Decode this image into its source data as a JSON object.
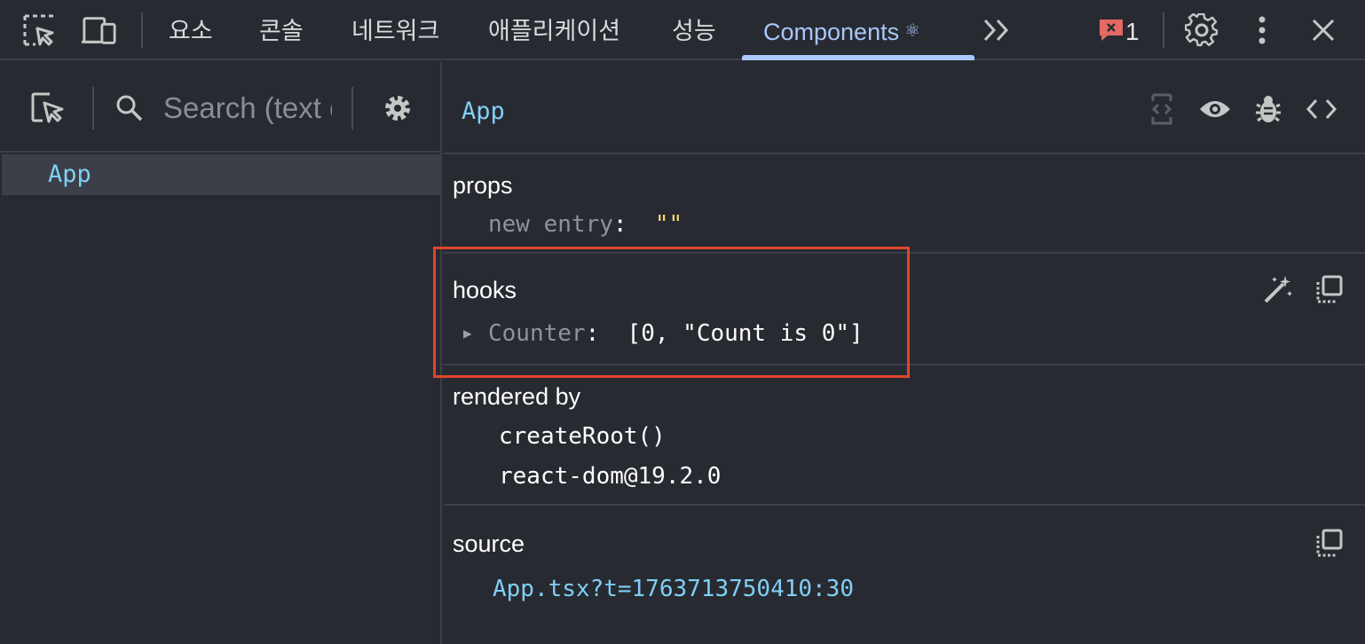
{
  "toolbar": {
    "tabs": [
      {
        "label": "요소"
      },
      {
        "label": "콘솔"
      },
      {
        "label": "네트워크"
      },
      {
        "label": "애플리케이션"
      },
      {
        "label": "성능"
      },
      {
        "label": "Components"
      }
    ],
    "react_glyph": "⚛",
    "more_tabs_glyph": "≫",
    "issues_count": "1",
    "icons": [
      "inspect-element-icon",
      "device-toolbar-icon",
      "issues-icon",
      "settings-gear-icon",
      "more-vert-icon",
      "close-icon"
    ],
    "active_tab": "Components",
    "accent_color": "#a8c7fa"
  },
  "tree": {
    "search_placeholder": "Search (text or /regex/)",
    "rows": [
      {
        "label": "App",
        "selected": true
      }
    ]
  },
  "inspector": {
    "component_name": "App",
    "props": {
      "title": "props",
      "new_entry_key": "new entry",
      "new_entry_colon": ":",
      "new_entry_value": "\"\""
    },
    "hooks": {
      "title": "hooks",
      "items": [
        {
          "name": "Counter",
          "colon": ":",
          "value": "[0, \"Count is 0\"]"
        }
      ]
    },
    "rendered_by": {
      "title": "rendered by",
      "items": [
        "createRoot()",
        "react-dom@19.2.0"
      ]
    },
    "source": {
      "title": "source",
      "location": "App.tsx?t=1763713750410:30"
    },
    "highlight_color": "#e0452e"
  }
}
